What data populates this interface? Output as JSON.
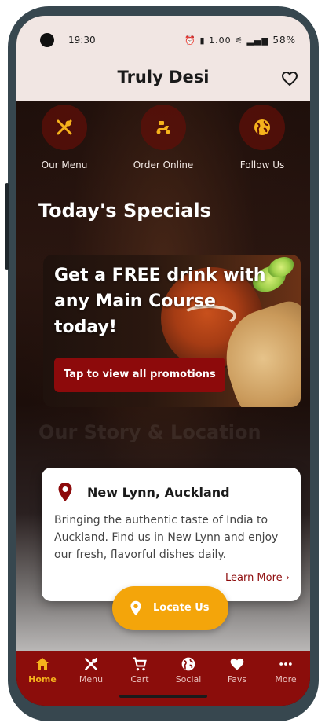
{
  "status_bar": {
    "time": "19:30",
    "icons_text": "⏰ ▮ 1.00 ⚟ ▂▄▆",
    "battery": "58%"
  },
  "header": {
    "title": "Truly Desi",
    "favorite_icon": "heart-outline-icon"
  },
  "quick_actions": [
    {
      "label": "Our Menu",
      "icon": "utensils-icon"
    },
    {
      "label": "Order Online",
      "icon": "scooter-icon"
    },
    {
      "label": "Follow Us",
      "icon": "globe-icon"
    }
  ],
  "specials": {
    "title": "Today's Specials",
    "promo_text": "Get a FREE drink with any Main Course today!",
    "promo_button": "Tap to view all promotions"
  },
  "story": {
    "title": "Our Story & Location",
    "location_name": "New Lynn, Auckland",
    "description": "Bringing the authentic taste of India to Auckland. Find us in New Lynn and enjoy our fresh, flavorful dishes daily.",
    "learn_more": "Learn More ›",
    "locate_button": "Locate Us"
  },
  "bottom_nav": [
    {
      "label": "Home",
      "icon": "home-icon",
      "active": true
    },
    {
      "label": "Menu",
      "icon": "utensils-icon",
      "active": false
    },
    {
      "label": "Cart",
      "icon": "cart-icon",
      "active": false
    },
    {
      "label": "Social",
      "icon": "globe-icon",
      "active": false
    },
    {
      "label": "Favs",
      "icon": "heart-icon",
      "active": false
    },
    {
      "label": "More",
      "icon": "more-icon",
      "active": false
    }
  ],
  "colors": {
    "brand_red": "#8d0a0b",
    "accent_orange": "#f4a50a",
    "active_nav": "#f5b21c"
  }
}
